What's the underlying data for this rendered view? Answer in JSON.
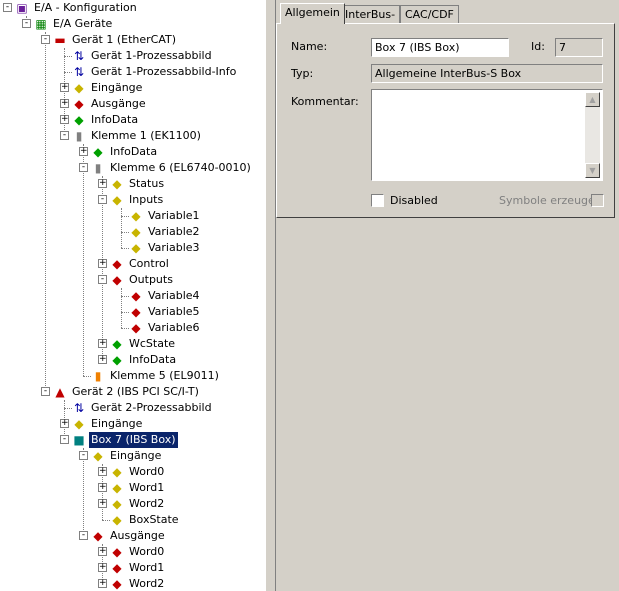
{
  "tree": [
    {
      "label": "E/A - Konfiguration",
      "icon": "io-config-icon",
      "depth": 0,
      "expander": "-"
    },
    {
      "label": "E/A Geräte",
      "icon": "io-devices-icon",
      "depth": 1,
      "expander": "-"
    },
    {
      "label": "Gerät 1 (EtherCAT)",
      "icon": "ethercat-device-icon",
      "depth": 2,
      "expander": "-"
    },
    {
      "label": "Gerät 1-Prozessabbild",
      "icon": "process-image-icon",
      "depth": 3,
      "expander": ""
    },
    {
      "label": "Gerät 1-Prozessabbild-Info",
      "icon": "process-image-icon",
      "depth": 3,
      "expander": ""
    },
    {
      "label": "Eingänge",
      "icon": "input-vars-icon",
      "depth": 3,
      "expander": "+"
    },
    {
      "label": "Ausgänge",
      "icon": "output-vars-icon",
      "depth": 3,
      "expander": "+"
    },
    {
      "label": "InfoData",
      "icon": "infodata-icon",
      "depth": 3,
      "expander": "+"
    },
    {
      "label": "Klemme 1 (EK1100)",
      "icon": "terminal-icon",
      "depth": 3,
      "expander": "-"
    },
    {
      "label": "InfoData",
      "icon": "infodata-icon",
      "depth": 4,
      "expander": "+"
    },
    {
      "label": "Klemme 6 (EL6740-0010)",
      "icon": "terminal-icon",
      "depth": 4,
      "expander": "-"
    },
    {
      "label": "Status",
      "icon": "input-vars-icon",
      "depth": 5,
      "expander": "+"
    },
    {
      "label": "Inputs",
      "icon": "input-vars-icon",
      "depth": 5,
      "expander": "-"
    },
    {
      "label": "Variable1",
      "icon": "input-var-icon",
      "depth": 6,
      "expander": ""
    },
    {
      "label": "Variable2",
      "icon": "input-var-icon",
      "depth": 6,
      "expander": ""
    },
    {
      "label": "Variable3",
      "icon": "input-var-icon",
      "depth": 6,
      "expander": ""
    },
    {
      "label": "Control",
      "icon": "output-vars-icon",
      "depth": 5,
      "expander": "+"
    },
    {
      "label": "Outputs",
      "icon": "output-vars-icon",
      "depth": 5,
      "expander": "-"
    },
    {
      "label": "Variable4",
      "icon": "output-var-icon",
      "depth": 6,
      "expander": ""
    },
    {
      "label": "Variable5",
      "icon": "output-var-icon",
      "depth": 6,
      "expander": ""
    },
    {
      "label": "Variable6",
      "icon": "output-var-icon",
      "depth": 6,
      "expander": ""
    },
    {
      "label": "WcState",
      "icon": "infodata-icon",
      "depth": 5,
      "expander": "+"
    },
    {
      "label": "InfoData",
      "icon": "infodata-icon",
      "depth": 5,
      "expander": "+"
    },
    {
      "label": "Klemme 5 (EL9011)",
      "icon": "end-terminal-icon",
      "depth": 4,
      "expander": ""
    },
    {
      "label": "Gerät 2 (IBS PCI SC/I-T)",
      "icon": "interbus-device-icon",
      "depth": 2,
      "expander": "-"
    },
    {
      "label": "Gerät 2-Prozessabbild",
      "icon": "process-image-icon",
      "depth": 3,
      "expander": ""
    },
    {
      "label": "Eingänge",
      "icon": "input-vars-icon",
      "depth": 3,
      "expander": "+"
    },
    {
      "label": "Box 7 (IBS Box)",
      "icon": "box-icon",
      "depth": 3,
      "expander": "-",
      "selected": true
    },
    {
      "label": "Eingänge",
      "icon": "input-vars-icon",
      "depth": 4,
      "expander": "-"
    },
    {
      "label": "Word0",
      "icon": "input-word-icon",
      "depth": 5,
      "expander": "+"
    },
    {
      "label": "Word1",
      "icon": "input-word-icon",
      "depth": 5,
      "expander": "+"
    },
    {
      "label": "Word2",
      "icon": "input-word-icon",
      "depth": 5,
      "expander": "+"
    },
    {
      "label": "BoxState",
      "icon": "input-var-icon",
      "depth": 5,
      "expander": ""
    },
    {
      "label": "Ausgänge",
      "icon": "output-vars-icon",
      "depth": 4,
      "expander": "-"
    },
    {
      "label": "Word0",
      "icon": "output-word-icon",
      "depth": 5,
      "expander": "+"
    },
    {
      "label": "Word1",
      "icon": "output-word-icon",
      "depth": 5,
      "expander": "+"
    },
    {
      "label": "Word2",
      "icon": "output-word-icon",
      "depth": 5,
      "expander": "+"
    }
  ],
  "tabs": [
    "Allgemein",
    "InterBus-S",
    "CAC/CDF"
  ],
  "form": {
    "name_label": "Name:",
    "name_value": "Box 7 (IBS Box)",
    "id_label": "Id:",
    "id_value": "7",
    "typ_label": "Typ:",
    "typ_value": "Allgemeine InterBus-S Box",
    "comment_label": "Kommentar:",
    "comment_value": "",
    "disabled_label": "Disabled",
    "symbols_label": "Symbole erzeugen"
  },
  "colors": {
    "selection": "#0a246a",
    "input": "#c8b400",
    "output": "#c00000",
    "green": "#00a000"
  }
}
